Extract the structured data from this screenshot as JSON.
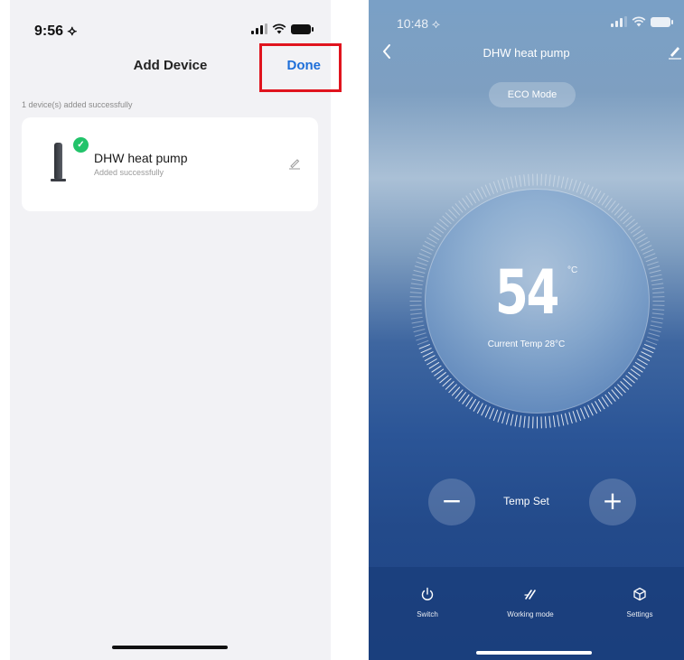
{
  "left": {
    "status_time": "9:56 ⟡",
    "title": "Add Device",
    "done_label": "Done",
    "success_text": "1 device(s) added successfully",
    "device": {
      "name": "DHW heat pump",
      "status": "Added successfully"
    }
  },
  "right": {
    "status_time": "10:48 ⟡",
    "title": "DHW heat pump",
    "eco_label": "ECO Mode",
    "set_temp": "54",
    "temp_unit": "°C",
    "current_temp": "Current Temp 28°C",
    "temp_set_label": "Temp Set",
    "minus": "−",
    "plus": "+",
    "bottom_bar": {
      "switch": "Switch",
      "mode": "Working mode",
      "settings": "Settings"
    }
  },
  "colors": {
    "done": "#1e6fd9",
    "highlight": "#e0141e",
    "check": "#22c36a"
  },
  "icons": [
    "location-arrow-icon",
    "cellular-signal-icon",
    "wifi-icon",
    "battery-icon",
    "check-icon",
    "heat-pump-icon",
    "edit-pencil-icon",
    "back-chevron-icon",
    "power-icon",
    "working-mode-icon",
    "settings-cube-icon"
  ]
}
